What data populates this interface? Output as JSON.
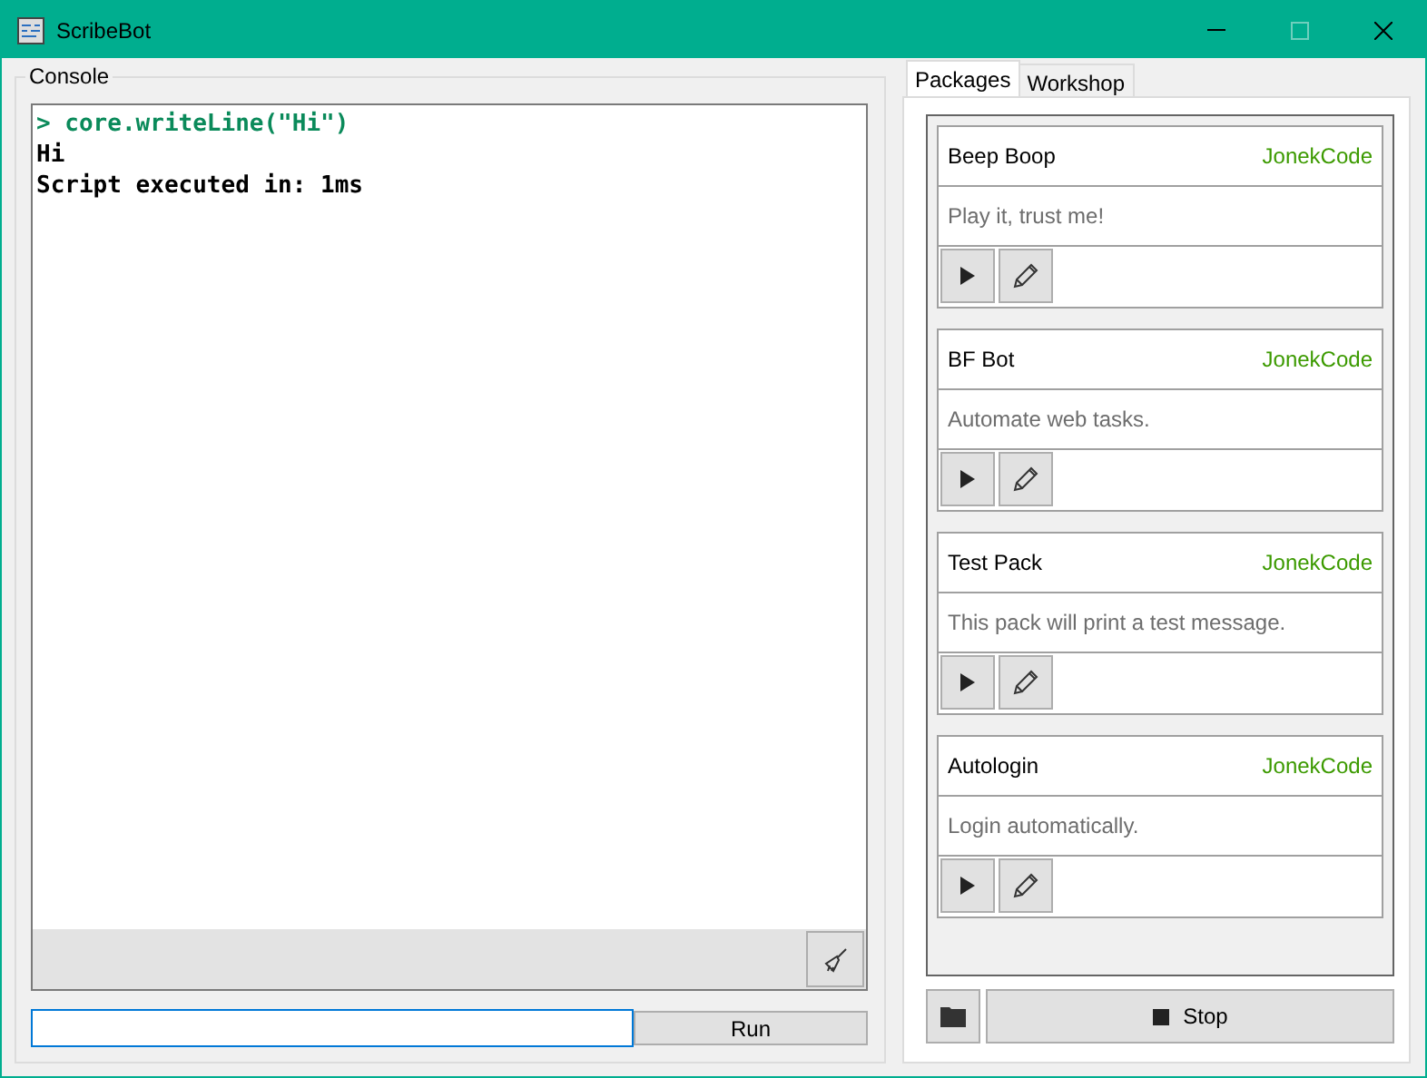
{
  "window": {
    "title": "ScribeBot",
    "maximize_disabled": true
  },
  "console": {
    "title": "Console",
    "lines": [
      {
        "kind": "input",
        "text": "> core.writeLine(\"Hi\")"
      },
      {
        "kind": "output",
        "text": "Hi"
      },
      {
        "kind": "output",
        "text": "Script executed in: 1ms"
      }
    ],
    "run_button": "Run"
  },
  "tabs": [
    {
      "label": "Packages",
      "selected": true
    },
    {
      "label": "Workshop",
      "selected": false
    }
  ],
  "packages": [
    {
      "name": "Beep Boop",
      "author": "JonekCode",
      "description": "Play it, trust me!"
    },
    {
      "name": "BF Bot",
      "author": "JonekCode",
      "description": "Automate web tasks."
    },
    {
      "name": "Test Pack",
      "author": "JonekCode",
      "description": "This pack will print a test message."
    },
    {
      "name": "Autologin",
      "author": "JonekCode",
      "description": "Login automatically."
    }
  ],
  "stop_button": "Stop"
}
